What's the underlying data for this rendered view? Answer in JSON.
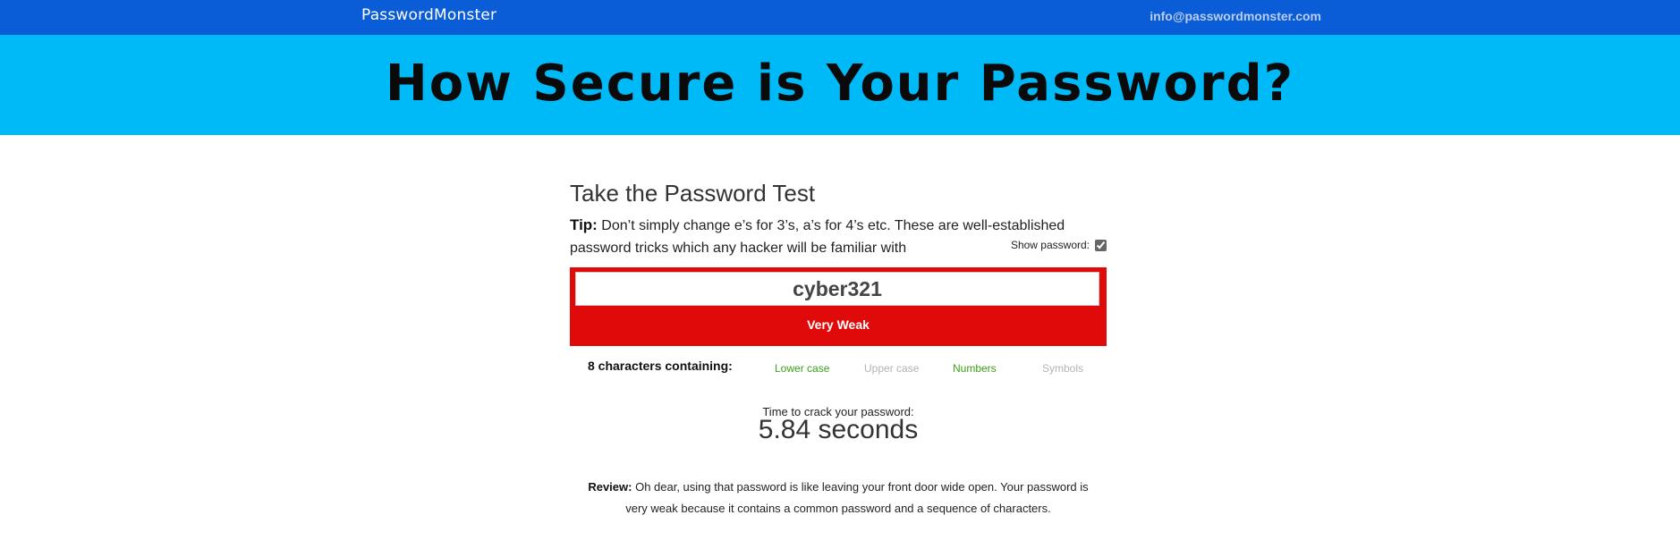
{
  "header": {
    "brand": "PasswordMonster",
    "email": "info@passwordmonster.com"
  },
  "hero": {
    "title": "How Secure is Your Password?"
  },
  "test": {
    "title": "Take the Password Test",
    "tip_label": "Tip:",
    "tip_text": " Don’t simply change e’s for 3’s, a’s for 4’s etc. These are well-established password tricks which any hacker will be familiar with",
    "show_password_label": "Show password:",
    "show_password_checked": true,
    "password_value": "cyber321",
    "strength": "Very Weak",
    "strength_color": "#e10a0a",
    "chars_summary": "8 characters containing:",
    "categories": [
      {
        "label": "Lower case",
        "present": true
      },
      {
        "label": "Upper case",
        "present": false
      },
      {
        "label": "Numbers",
        "present": true
      },
      {
        "label": "Symbols",
        "present": false
      }
    ],
    "crack_label": "Time to crack your password:",
    "crack_time": "5.84 seconds",
    "review_label": "Review:",
    "review_text": " Oh dear, using that password is like leaving your front door wide open. Your password is very weak because it contains a common password and a sequence of characters."
  },
  "colors": {
    "topbar": "#0b5dd7",
    "hero": "#00b9f7",
    "present": "#3aa019",
    "absent": "#b3b3b3"
  }
}
